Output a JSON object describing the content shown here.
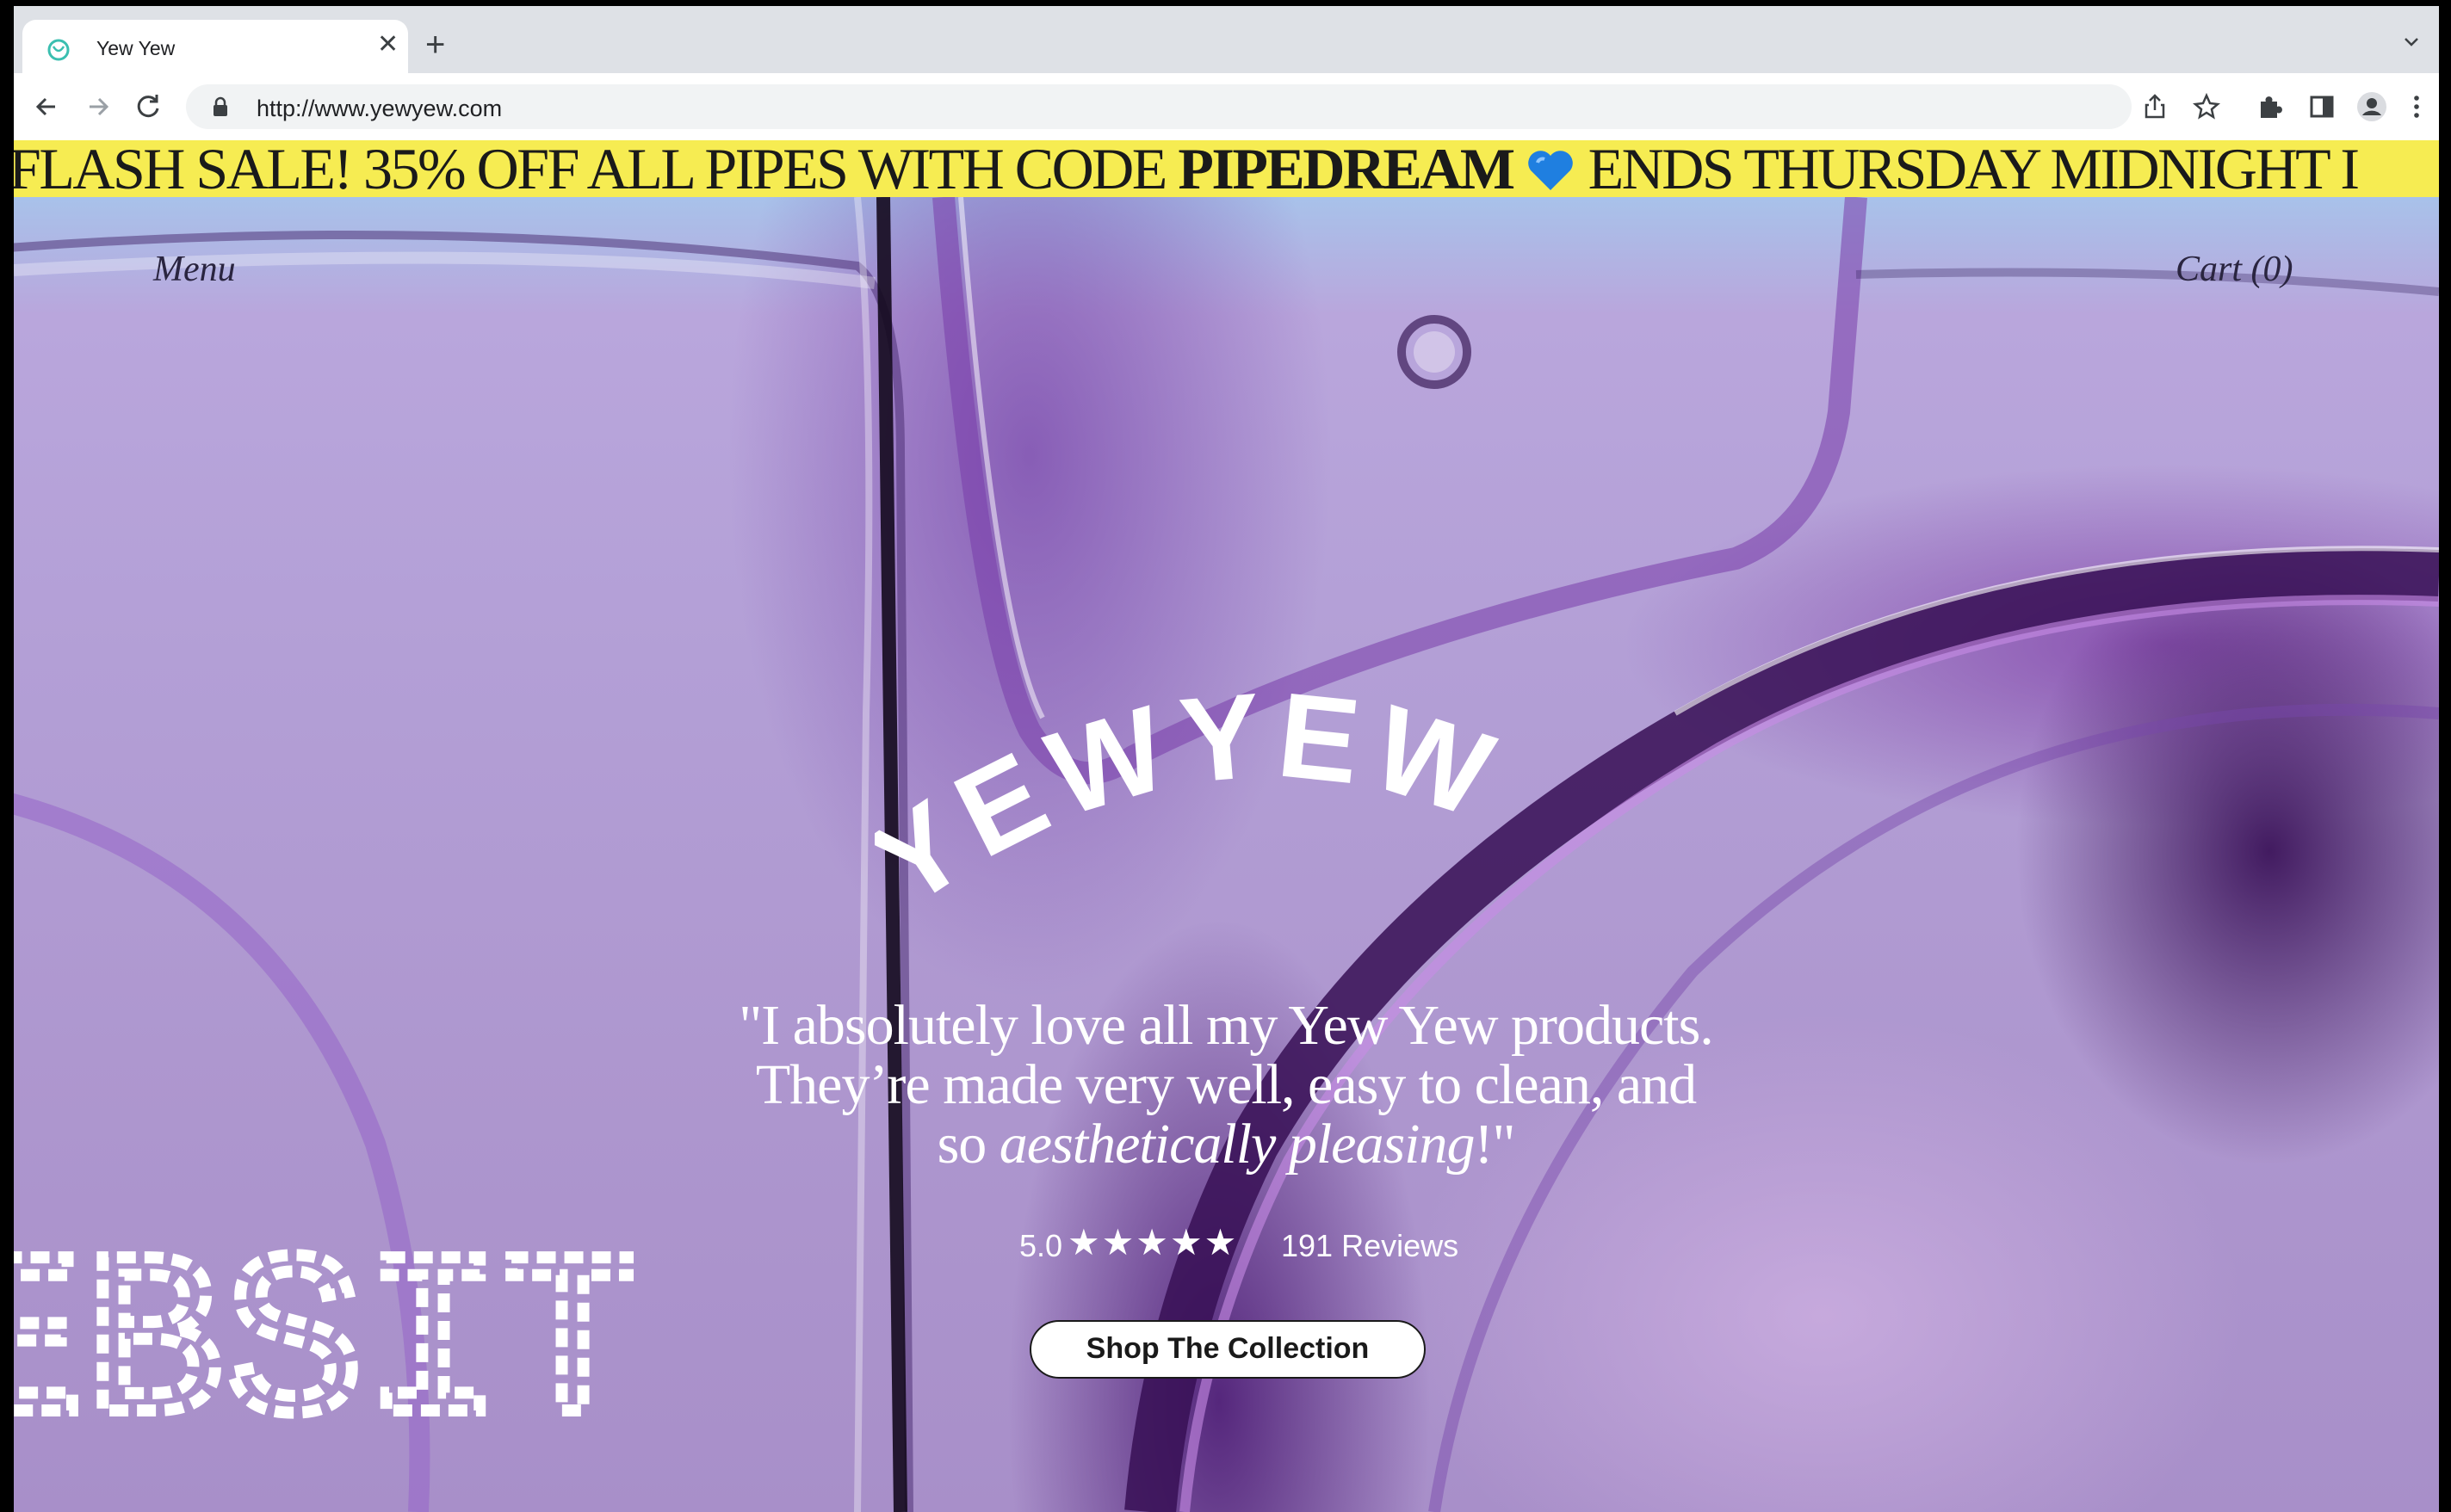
{
  "browser": {
    "tab_title": "Yew Yew",
    "url": "http://www.yewyew.com"
  },
  "banner": {
    "text_before": "FLASH SALE! 35% OFF ALL PIPES WITH CODE ",
    "code": "PIPEDREAM",
    "text_after": " ENDS THURSDAY MIDNIGHT I",
    "background_color": "#f6ec52",
    "heart_icon": "blue-heart-icon"
  },
  "header": {
    "menu_label": "Menu",
    "cart_label": "Cart (0)"
  },
  "hero": {
    "logo_text": "YEWYEW",
    "quote_line1": "\"I absolutely love all my Yew Yew products.",
    "quote_line2": "They’re made very well, easy to clean, and",
    "quote_line3_plain": "so ",
    "quote_line3_italic": "aesthetically pleasing",
    "quote_line3_end": "!\"",
    "rating_score": "5.0",
    "rating_stars": "★★★★★",
    "rating_value": 5,
    "reviews_count": "191 Reviews",
    "cta_label": "Shop The Collection",
    "pixel_text": "EBSITE"
  }
}
